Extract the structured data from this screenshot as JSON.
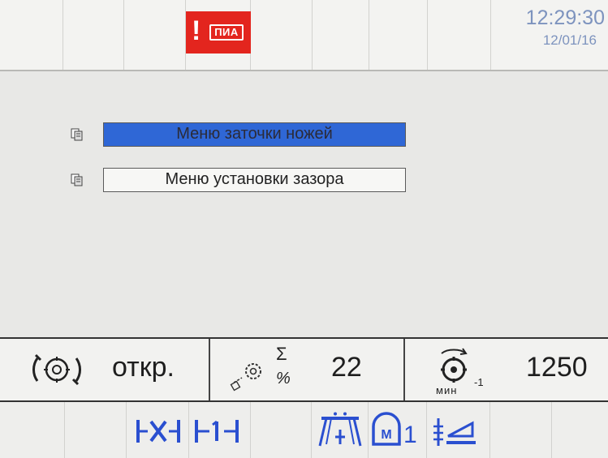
{
  "header": {
    "alarm_icon_name": "warning-excl-icon",
    "alarm_excl": "!",
    "alarm_tag": "ПИА",
    "time": "12:29:30",
    "date": "12/01/16"
  },
  "menu": {
    "items": [
      {
        "label": "Меню заточки ножей",
        "selected": true
      },
      {
        "label": "Меню установки зазора",
        "selected": false
      }
    ]
  },
  "status": {
    "knife_state": "откр.",
    "count": "22",
    "rpm": "1250",
    "rpm_unit": "мин",
    "rpm_unit_exp": "-1",
    "sum_symbol": "Σ",
    "percent_symbol": "%"
  },
  "bottom": {
    "m_button_sub": "1"
  },
  "colors": {
    "accent_blue": "#2a4fd0",
    "selected_bg": "#2f67d6",
    "alarm_red": "#e3251e",
    "clock": "#7d93be"
  }
}
